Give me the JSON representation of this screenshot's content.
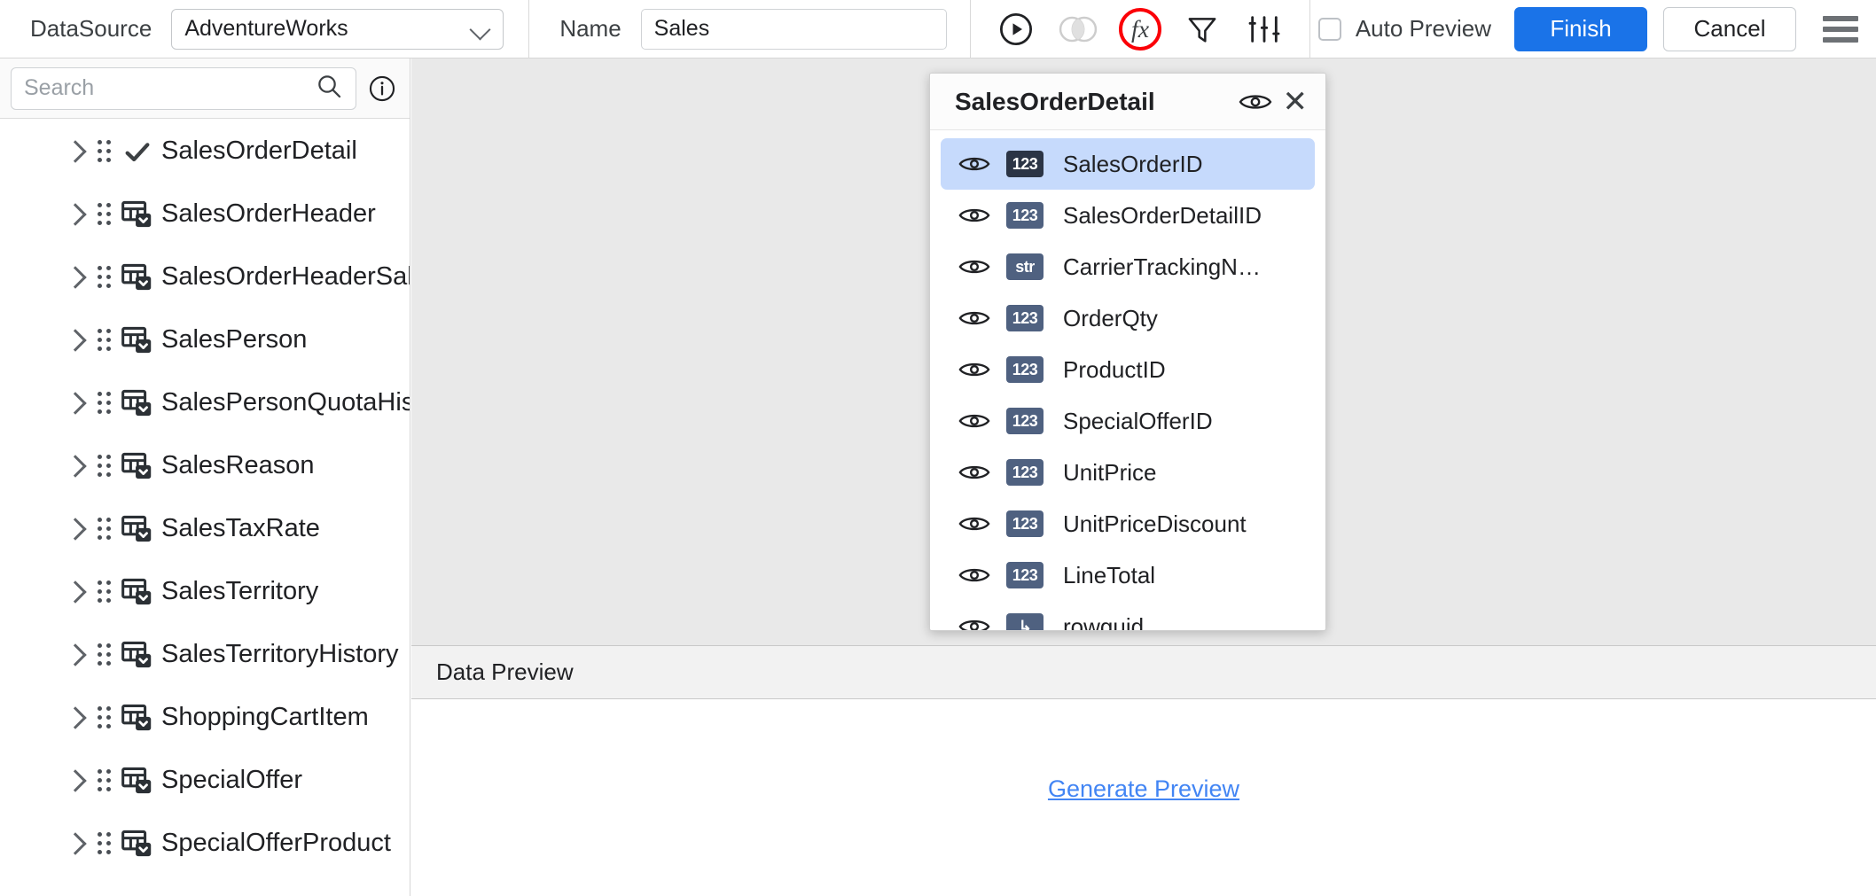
{
  "toolbar": {
    "datasource_label": "DataSource",
    "datasource_value": "AdventureWorks",
    "name_label": "Name",
    "name_value": "Sales",
    "icons": [
      {
        "name": "run-preview-icon",
        "title": "Run"
      },
      {
        "name": "join-icon",
        "title": "Join"
      },
      {
        "name": "fx-formula-icon",
        "title": "fx",
        "highlighted": true,
        "highlight_color": "#fb0007"
      },
      {
        "name": "filter-icon",
        "title": "Filter"
      },
      {
        "name": "settings-sliders-icon",
        "title": "Settings"
      }
    ],
    "auto_preview_label": "Auto Preview",
    "auto_preview_checked": false,
    "finish_label": "Finish",
    "cancel_label": "Cancel",
    "menu_icon": "hamburger-menu-icon",
    "primary_color": "#1a73e8"
  },
  "sidebar": {
    "search_placeholder": "Search",
    "search_value": "",
    "search_icon": "search-icon",
    "info_icon": "info-circle-icon",
    "items": [
      {
        "label": "SalesOrderDetail",
        "icon": "check-icon",
        "selected": true
      },
      {
        "label": "SalesOrderHeader",
        "icon": "table-dropdown-icon",
        "selected": false
      },
      {
        "label": "SalesOrderHeaderSalesReason",
        "icon": "table-dropdown-icon",
        "selected": false
      },
      {
        "label": "SalesPerson",
        "icon": "table-dropdown-icon",
        "selected": false
      },
      {
        "label": "SalesPersonQuotaHistory",
        "icon": "table-dropdown-icon",
        "selected": false
      },
      {
        "label": "SalesReason",
        "icon": "table-dropdown-icon",
        "selected": false
      },
      {
        "label": "SalesTaxRate",
        "icon": "table-dropdown-icon",
        "selected": false
      },
      {
        "label": "SalesTerritory",
        "icon": "table-dropdown-icon",
        "selected": false
      },
      {
        "label": "SalesTerritoryHistory",
        "icon": "table-dropdown-icon",
        "selected": false
      },
      {
        "label": "ShoppingCartItem",
        "icon": "table-dropdown-icon",
        "selected": false
      },
      {
        "label": "SpecialOffer",
        "icon": "table-dropdown-icon",
        "selected": false
      },
      {
        "label": "SpecialOfferProduct",
        "icon": "table-dropdown-icon",
        "selected": false
      }
    ]
  },
  "field_popup": {
    "title": "SalesOrderDetail",
    "eye_icon": "eye-icon",
    "close_icon": "close-icon",
    "fields": [
      {
        "name": "SalesOrderID",
        "type": "123",
        "selected": true
      },
      {
        "name": "SalesOrderDetailID",
        "type": "123",
        "selected": false
      },
      {
        "name": "CarrierTrackingN…",
        "type": "str",
        "selected": false
      },
      {
        "name": "OrderQty",
        "type": "123",
        "selected": false
      },
      {
        "name": "ProductID",
        "type": "123",
        "selected": false
      },
      {
        "name": "SpecialOfferID",
        "type": "123",
        "selected": false
      },
      {
        "name": "UnitPrice",
        "type": "123",
        "selected": false
      },
      {
        "name": "UnitPriceDiscount",
        "type": "123",
        "selected": false
      },
      {
        "name": "LineTotal",
        "type": "123",
        "selected": false
      },
      {
        "name": "rowguid",
        "type": "↳",
        "selected": false
      }
    ]
  },
  "preview": {
    "header_label": "Data Preview",
    "generate_link": "Generate Preview",
    "link_color": "#4285f4"
  }
}
